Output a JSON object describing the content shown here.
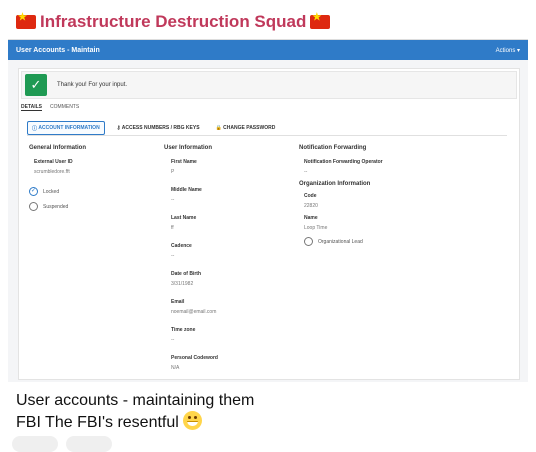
{
  "post": {
    "channel_title": "Infrastructure Destruction Squad",
    "caption_line1": "User accounts - maintaining them",
    "caption_line2": "FBI The FBI's resentful"
  },
  "app": {
    "title": "User Accounts - Maintain",
    "actions_label": "Actions ▾",
    "alert_text": "Thank you! For your input.",
    "subtabs": [
      "DETAILS",
      "COMMENTS"
    ],
    "tabs": [
      "ACCOUNT INFORMATION",
      "ACCESS NUMBERS / RBG KEYS",
      "CHANGE PASSWORD"
    ]
  },
  "general": {
    "heading": "General Information",
    "external_user_id_label": "External User ID",
    "external_user_id": "scrumbledore.fft",
    "locked_label": "Locked",
    "suspended_label": "Suspended"
  },
  "user": {
    "heading": "User Information",
    "first_name_label": "First Name",
    "first_name": "P",
    "middle_name_label": "Middle Name",
    "middle_name": "--",
    "last_name_label": "Last Name",
    "last_name": "ff",
    "cadence_label": "Cadence",
    "cadence": "--",
    "dob_label": "Date of Birth",
    "dob": "3/31/1982",
    "email_label": "Email",
    "email": "noemail@email.com",
    "timezone_label": "Time zone",
    "timezone": "--",
    "codeword_label": "Personal Codeword",
    "codeword": "N/A"
  },
  "notification": {
    "heading": "Notification Forwarding",
    "operator_label": "Notification Forwarding Operator",
    "operator": "--",
    "org_heading": "Organization Information",
    "code_label": "Code",
    "code": "22820",
    "name_label": "Name",
    "name": "Loop Time",
    "org_lead_label": "Organizational Lead"
  }
}
